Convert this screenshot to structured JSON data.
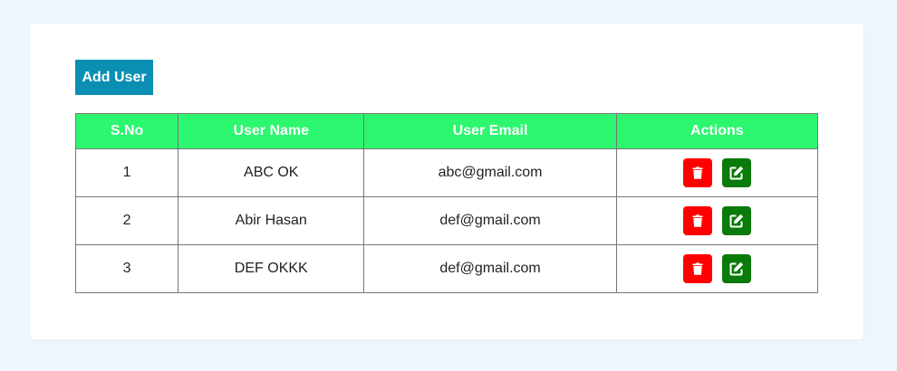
{
  "toolbar": {
    "add_user_label": "Add User"
  },
  "table": {
    "headers": {
      "sno": "S.No",
      "name": "User Name",
      "email": "User Email",
      "actions": "Actions"
    },
    "rows": [
      {
        "sno": "1",
        "name": "ABC OK",
        "email": "abc@gmail.com"
      },
      {
        "sno": "2",
        "name": "Abir Hasan",
        "email": "def@gmail.com"
      },
      {
        "sno": "3",
        "name": "DEF OKKK",
        "email": "def@gmail.com"
      }
    ]
  },
  "icons": {
    "delete": "trash-icon",
    "edit": "edit-icon"
  },
  "colors": {
    "page_background": "#eef5fd",
    "add_button": "#0a8fb3",
    "header_background": "#2cf76f",
    "delete_button": "#ff0000",
    "edit_button": "#0a7a0a"
  }
}
